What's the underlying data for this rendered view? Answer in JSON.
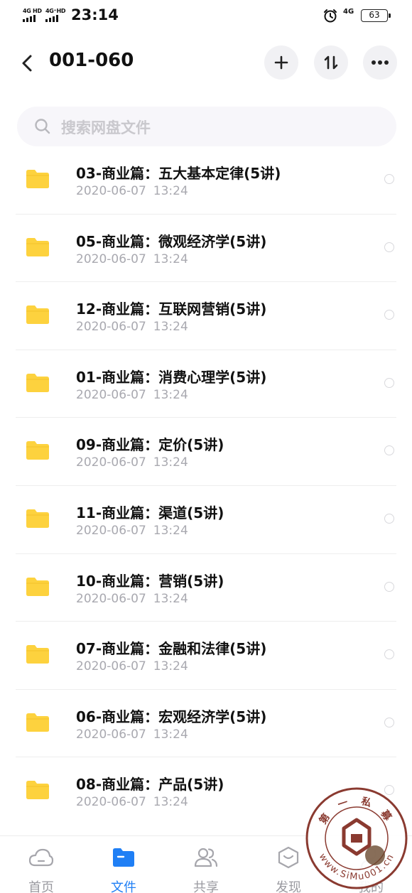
{
  "status_bar": {
    "net1": "4G HD",
    "net2": "4G⁺HD",
    "time": "23:14",
    "net3": "4G",
    "battery": "63"
  },
  "header": {
    "title": "001-060",
    "back_icon": "chevron-left-icon",
    "add_icon": "plus-icon",
    "sort_icon": "sort-icon",
    "more_icon": "more-horizontal-icon"
  },
  "search": {
    "placeholder": "搜索网盘文件"
  },
  "files": [
    {
      "name": "03-商业篇：五大基本定律(5讲)",
      "date": "2020-06-07",
      "time": "13:24"
    },
    {
      "name": "05-商业篇：微观经济学(5讲)",
      "date": "2020-06-07",
      "time": "13:24"
    },
    {
      "name": "12-商业篇：互联网营销(5讲)",
      "date": "2020-06-07",
      "time": "13:24"
    },
    {
      "name": "01-商业篇：消费心理学(5讲)",
      "date": "2020-06-07",
      "time": "13:24"
    },
    {
      "name": "09-商业篇：定价(5讲)",
      "date": "2020-06-07",
      "time": "13:24"
    },
    {
      "name": "11-商业篇：渠道(5讲)",
      "date": "2020-06-07",
      "time": "13:24"
    },
    {
      "name": "10-商业篇：营销(5讲)",
      "date": "2020-06-07",
      "time": "13:24"
    },
    {
      "name": "07-商业篇：金融和法律(5讲)",
      "date": "2020-06-07",
      "time": "13:24"
    },
    {
      "name": "06-商业篇：宏观经济学(5讲)",
      "date": "2020-06-07",
      "time": "13:24"
    },
    {
      "name": "08-商业篇：产品(5讲)",
      "date": "2020-06-07",
      "time": "13:24"
    }
  ],
  "tabs": [
    {
      "label": "首页",
      "icon": "cloud-icon"
    },
    {
      "label": "文件",
      "icon": "folder-icon",
      "active": true
    },
    {
      "label": "共享",
      "icon": "people-icon"
    },
    {
      "label": "发现",
      "icon": "discover-icon"
    },
    {
      "label": "我的",
      "icon": "profile-icon"
    }
  ],
  "watermark": {
    "top_text": "第 一 私 募",
    "bottom_text": "www.SiMu001.cn"
  },
  "colors": {
    "accent": "#1f7ff5",
    "folder": "#fdd23e",
    "text_primary": "#111111",
    "text_secondary": "#a9a9b0"
  }
}
